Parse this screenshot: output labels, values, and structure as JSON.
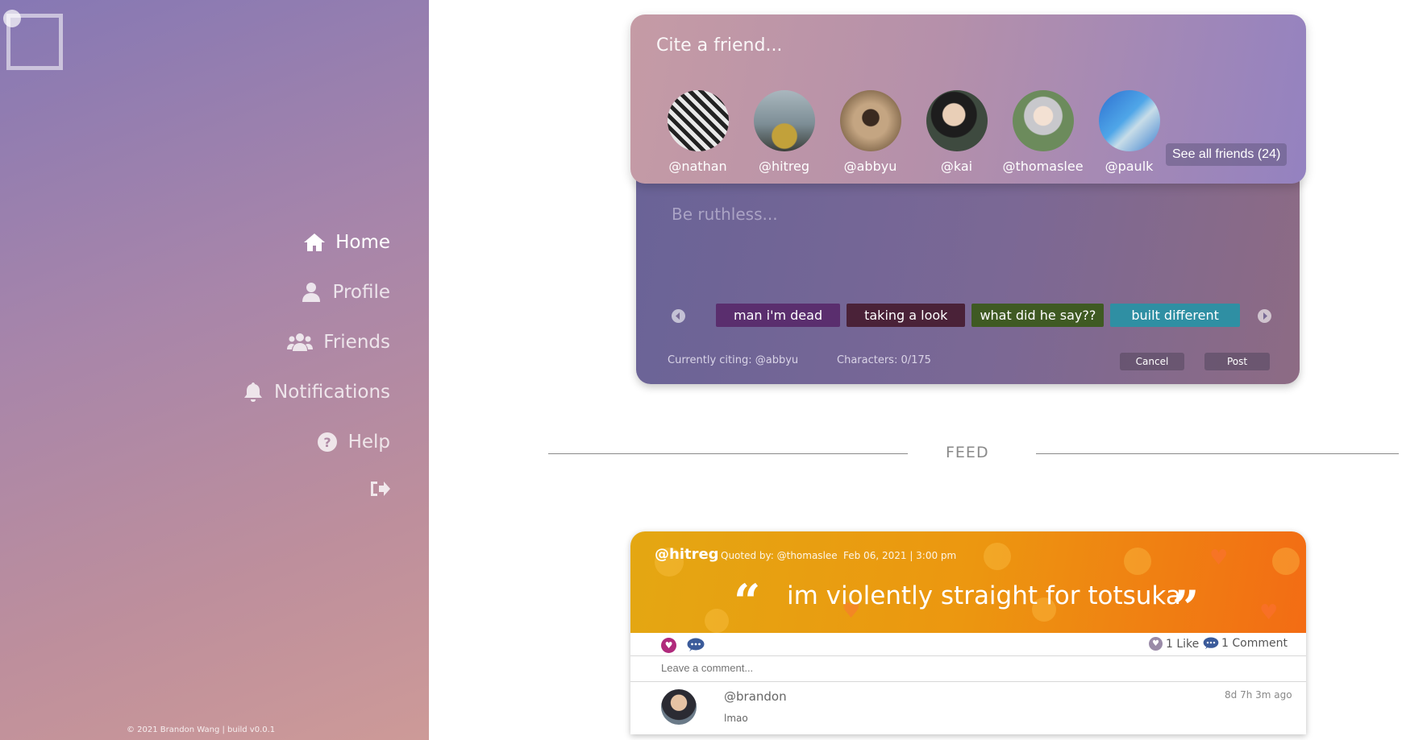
{
  "sidebar": {
    "nav": [
      {
        "label": "Home",
        "icon": "home-icon",
        "active": true
      },
      {
        "label": "Profile",
        "icon": "user-icon",
        "active": false
      },
      {
        "label": "Friends",
        "icon": "friends-icon",
        "active": false
      },
      {
        "label": "Notifications",
        "icon": "bell-icon",
        "active": false
      },
      {
        "label": "Help",
        "icon": "help-icon",
        "active": false
      }
    ],
    "logout_icon": "logout-icon",
    "copyright": "© 2021 Brandon Wang | build v0.0.1"
  },
  "cite": {
    "placeholder": "Cite a friend...",
    "friends": [
      {
        "handle": "@nathan"
      },
      {
        "handle": "@hitreg"
      },
      {
        "handle": "@abbyu"
      },
      {
        "handle": "@kai"
      },
      {
        "handle": "@thomaslee"
      },
      {
        "handle": "@paulk"
      }
    ],
    "see_all": "See all friends (24)"
  },
  "compose": {
    "placeholder": "Be ruthless...",
    "tags": [
      {
        "label": "man i'm dead",
        "color": "#5a2e6e"
      },
      {
        "label": "taking a look",
        "color": "#4a2238"
      },
      {
        "label": "what did he say??",
        "color": "#3f5a23"
      },
      {
        "label": "built different",
        "color": "#2f8fa3"
      }
    ],
    "currently_citing": "Currently citing: @abbyu",
    "characters": "Characters: 0/175",
    "cancel": "Cancel",
    "post": "Post"
  },
  "feed": {
    "label": "FEED",
    "post": {
      "author": "@hitreg",
      "quoted_by": "Quoted by: @thomaslee",
      "date": "Feb 06, 2021 | 3:00 pm",
      "text": "im violently straight for totsuka",
      "likes": "1 Like",
      "comments": "1 Comment",
      "comment_placeholder": "Leave a comment...",
      "comment_list": [
        {
          "user": "@brandon",
          "text": "lmao",
          "time": "8d 7h 3m ago"
        }
      ]
    }
  }
}
